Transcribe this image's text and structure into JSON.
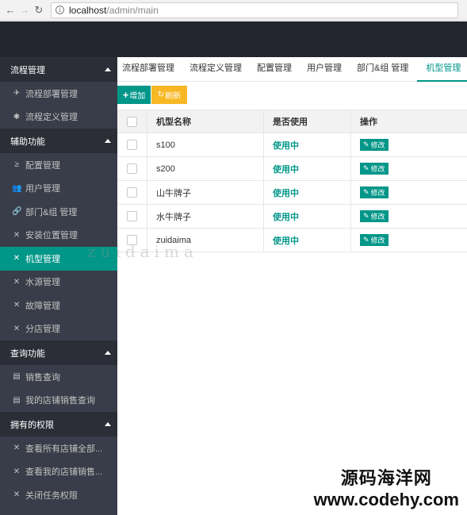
{
  "browser": {
    "url_host": "localhost",
    "url_path": "/admin/main"
  },
  "sidebar": {
    "sections": [
      {
        "title": "流程管理",
        "items": [
          {
            "icon": "send-icon",
            "glyph": "✈",
            "label": "流程部署管理"
          },
          {
            "icon": "gear-icon",
            "glyph": "✱",
            "label": "流程定义管理"
          }
        ]
      },
      {
        "title": "辅助功能",
        "items": [
          {
            "icon": "config-icon",
            "glyph": "≥",
            "label": "配置管理"
          },
          {
            "icon": "users-icon",
            "glyph": "👥",
            "label": "用户管理"
          },
          {
            "icon": "link-icon",
            "glyph": "🔗",
            "label": "部门&组 管理"
          },
          {
            "icon": "close-icon",
            "glyph": "✕",
            "label": "安装位置管理"
          },
          {
            "icon": "close-icon",
            "glyph": "✕",
            "label": "机型管理",
            "active": true
          },
          {
            "icon": "close-icon",
            "glyph": "✕",
            "label": "水源管理"
          },
          {
            "icon": "close-icon",
            "glyph": "✕",
            "label": "故障管理"
          },
          {
            "icon": "close-icon",
            "glyph": "✕",
            "label": "分店管理"
          }
        ]
      },
      {
        "title": "查询功能",
        "items": [
          {
            "icon": "doc-icon",
            "glyph": "▤",
            "label": "销售查询"
          },
          {
            "icon": "doc-icon",
            "glyph": "▤",
            "label": "我的店铺销售查询"
          }
        ]
      },
      {
        "title": "拥有的权限",
        "items": [
          {
            "icon": "close-icon",
            "glyph": "✕",
            "label": "查看所有店铺全部..."
          },
          {
            "icon": "close-icon",
            "glyph": "✕",
            "label": "查看我的店铺销售..."
          },
          {
            "icon": "close-icon",
            "glyph": "✕",
            "label": "关闭任务权限"
          }
        ]
      }
    ]
  },
  "tabs": [
    "流程部署管理",
    "流程定义管理",
    "配置管理",
    "用户管理",
    "部门&组 管理",
    "机型管理"
  ],
  "active_tab": 5,
  "toolbar": {
    "add_label": "增加",
    "refresh_label": "刷新"
  },
  "table": {
    "headers": [
      "机型名称",
      "是否使用",
      "操作"
    ],
    "rows": [
      {
        "name": "s100",
        "use": "使用中",
        "action": "修改"
      },
      {
        "name": "s200",
        "use": "使用中",
        "action": "修改"
      },
      {
        "name": "山牛牌子",
        "use": "使用中",
        "action": "修改"
      },
      {
        "name": "水牛牌子",
        "use": "使用中",
        "action": "修改"
      },
      {
        "name": "zuidaima",
        "use": "使用中",
        "action": "修改"
      }
    ]
  },
  "watermark": "zuidaima",
  "brand": {
    "cn": "源码海洋网",
    "url": "www.codehy.com"
  },
  "colors": {
    "accent": "#009688",
    "warning": "#f7b824",
    "sidebar_bg": "#393d49",
    "header_bg": "#23262e"
  }
}
